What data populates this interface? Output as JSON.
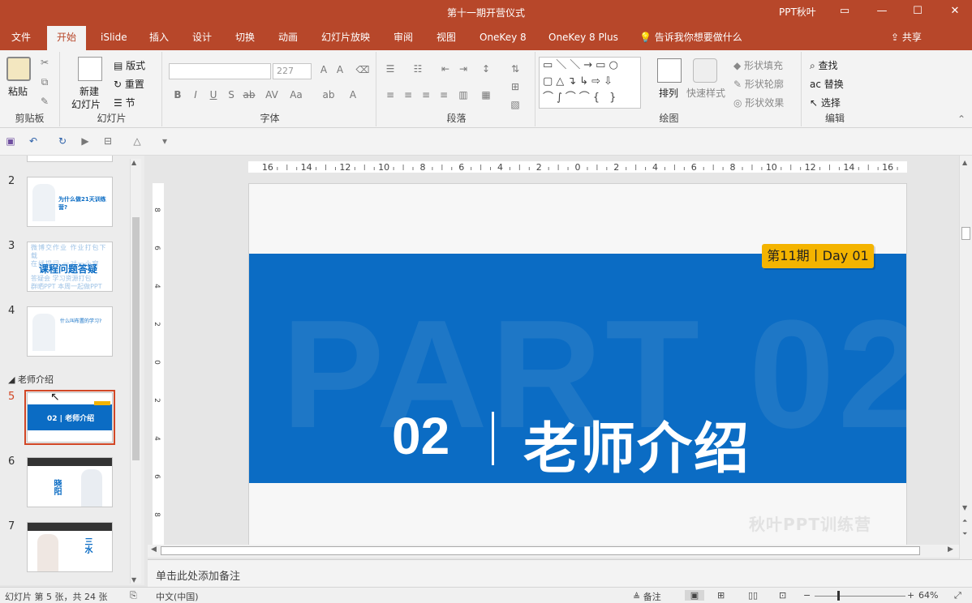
{
  "window": {
    "title": "第十一期开营仪式",
    "user": "PPT秋叶"
  },
  "tabs": [
    "文件",
    "开始",
    "iSlide",
    "插入",
    "设计",
    "切换",
    "动画",
    "幻灯片放映",
    "审阅",
    "视图",
    "OneKey 8",
    "OneKey 8 Plus"
  ],
  "tell_me": "告诉我你想要做什么",
  "share": "共享",
  "ribbon": {
    "clipboard": {
      "paste": "粘贴",
      "label": "剪贴板"
    },
    "slides": {
      "new_slide_1": "新建",
      "new_slide_2": "幻灯片",
      "layout": "版式",
      "reset": "重置",
      "section": "节",
      "label": "幻灯片"
    },
    "font": {
      "font_name": "",
      "font_size": "227",
      "label": "字体"
    },
    "paragraph": {
      "label": "段落"
    },
    "drawing": {
      "arrange": "排列",
      "quick_styles": "快速样式",
      "fill": "形状填充",
      "outline": "形状轮廓",
      "effects": "形状效果",
      "label": "绘图"
    },
    "editing": {
      "find": "查找",
      "replace": "替换",
      "select": "选择",
      "label": "编辑"
    }
  },
  "thumbnails": {
    "section_name": "老师介绍",
    "items": [
      {
        "num": "2",
        "text": "为什么做21天训练营?"
      },
      {
        "num": "3",
        "text": "课程问题答疑"
      },
      {
        "num": "4",
        "text": "什么叫布置的学习?"
      },
      {
        "num": "5",
        "text": "02 | 老师介绍"
      },
      {
        "num": "6",
        "text": "晓阳"
      },
      {
        "num": "7",
        "text": "三水"
      }
    ]
  },
  "ruler": {
    "h_ticks": [
      "16",
      "14",
      "12",
      "10",
      "8",
      "6",
      "4",
      "2",
      "0",
      "2",
      "4",
      "6",
      "8",
      "10",
      "12",
      "14",
      "16"
    ],
    "v_ticks": [
      "8",
      "6",
      "4",
      "2",
      "0",
      "2",
      "4",
      "6",
      "8"
    ]
  },
  "slide": {
    "badge": "第11期丨Day 01",
    "watermark": "PART 02",
    "number": "02",
    "title": "老师介绍",
    "brand": "秋叶PPT训练营",
    "colors": {
      "band": "#0b6cc4",
      "badge": "#f4b400",
      "accent": "#b7472a"
    }
  },
  "notes_placeholder": "单击此处添加备注",
  "status": {
    "slide_info": "幻灯片 第 5 张，共 24 张",
    "language": "中文(中国)",
    "notes_btn": "备注",
    "zoom": "64%"
  }
}
